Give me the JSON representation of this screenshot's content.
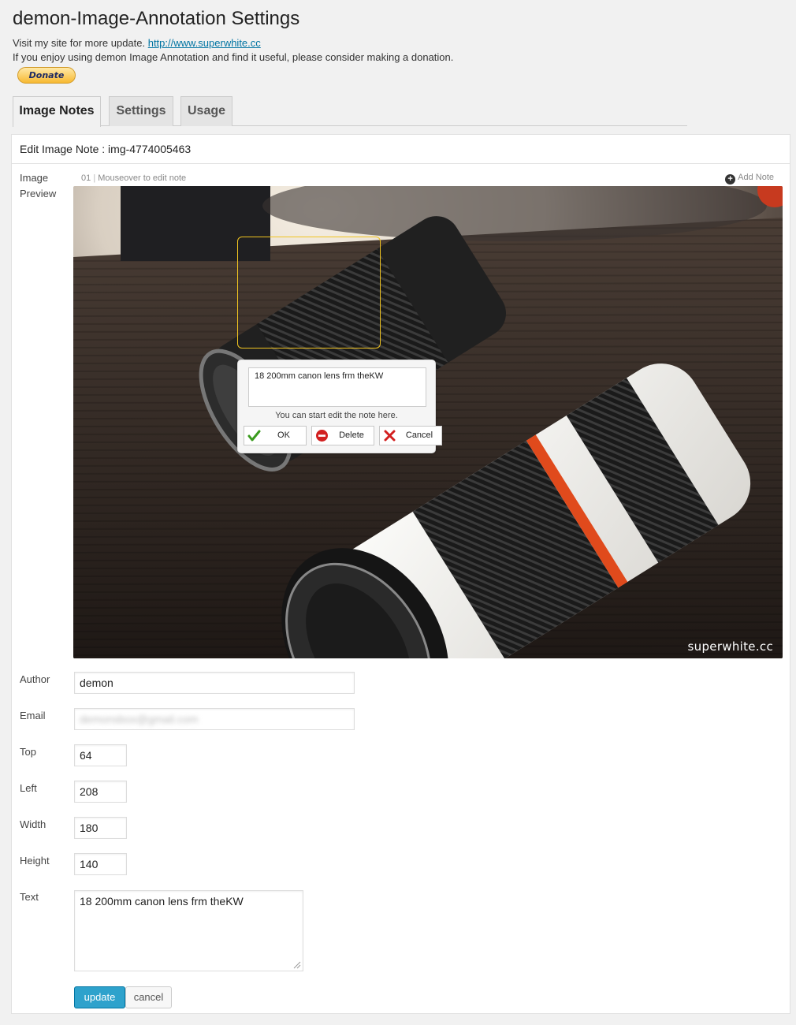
{
  "page": {
    "title": "demon-Image-Annotation Settings",
    "visit_text": "Visit my site for more update. ",
    "site_link": "http://www.superwhite.cc",
    "donation_text": "If you enjoy using demon Image Annotation and find it useful, please consider making a donation.",
    "donate_label": "Donate"
  },
  "tabs": [
    {
      "label": "Image Notes",
      "active": true
    },
    {
      "label": "Settings",
      "active": false
    },
    {
      "label": "Usage",
      "active": false
    }
  ],
  "editor": {
    "header": "Edit Image Note : img-4774005463",
    "preview_label_1": "Image",
    "preview_label_2": "Preview",
    "note_index": "01",
    "note_hint": "Mouseover to edit note",
    "add_note": "Add Note",
    "watermark": "superwhite.cc",
    "note_popup": {
      "text": "18 200mm canon lens frm theKW",
      "hint": "You can start edit the note here.",
      "ok": "OK",
      "delete": "Delete",
      "cancel": "Cancel"
    }
  },
  "form": {
    "author_label": "Author",
    "author_value": "demon",
    "email_label": "Email",
    "email_value": "demonsbox@gmail.com",
    "top_label": "Top",
    "top_value": "64",
    "left_label": "Left",
    "left_value": "208",
    "width_label": "Width",
    "width_value": "180",
    "height_label": "Height",
    "height_value": "140",
    "text_label": "Text",
    "text_value": "18 200mm canon lens frm theKW",
    "update_label": "update",
    "cancel_label": "cancel"
  },
  "colors": {
    "primary_button": "#2ea2cc",
    "note_border": "#f0c420",
    "link": "#0074a2"
  }
}
